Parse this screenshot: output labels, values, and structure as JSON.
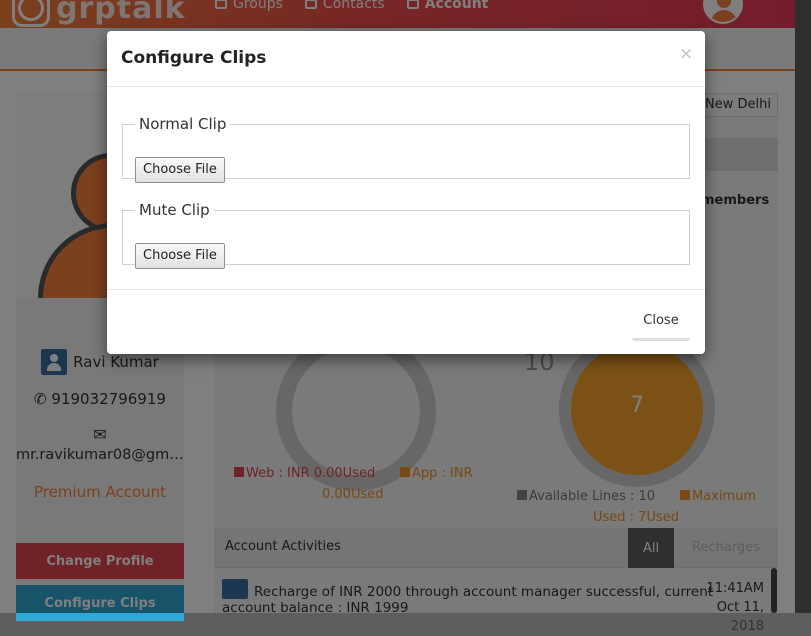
{
  "app": {
    "logo_text": "grptalk",
    "nav": [
      {
        "label": "Groups",
        "icon": "groups-icon"
      },
      {
        "label": "Contacts",
        "icon": "contacts-icon"
      },
      {
        "label": "Account",
        "icon": "account-icon"
      }
    ],
    "location": "New Delhi",
    "members_label": "members"
  },
  "sidebar": {
    "name": "Ravi Kumar",
    "phone": "919032796919",
    "email": "mr.ravikumar08@gmail...",
    "plan": "Premium Account",
    "change_profile": "Change Profile",
    "configure_clips": "Configure Clips"
  },
  "dashboard": {
    "lines_total": "10",
    "used_lines": "7",
    "legend_web": "Web : INR 0.00Used",
    "legend_app_1": "App : INR",
    "legend_app_2": "0.00Used",
    "legend_available": "Available Lines : 10",
    "legend_maximum": "Maximum",
    "legend_used": "Used : 7Used",
    "activities_title": "Account Activities",
    "tab_all": "All",
    "tab_recharges": "Recharges",
    "activity_text": "Recharge of INR 2000 through account manager successful, current account balance : INR 1999",
    "activity_time": "11:41AM Oct 11, 2018"
  },
  "modal": {
    "title": "Configure Clips",
    "close_symbol": "×",
    "normal_clip_legend": "Normal Clip",
    "mute_clip_legend": "Mute Clip",
    "choose_file_label": "Choose File",
    "close_button": "Close"
  },
  "colors": {
    "brand_orange": "#f6813a",
    "brand_red": "#e8395b",
    "change_profile_bg": "#e2454f",
    "configure_clips_bg": "#2fa8d5"
  }
}
